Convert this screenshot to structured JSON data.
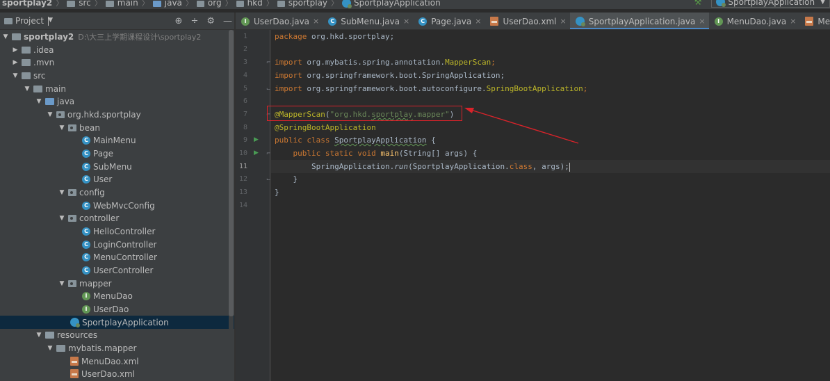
{
  "breadcrumb": {
    "items": [
      "sportplay2",
      "src",
      "main",
      "java",
      "org",
      "hkd",
      "sportplay",
      "SportplayApplication"
    ],
    "run_config": "SportplayApplication"
  },
  "project_panel": {
    "title": "Project",
    "tree": [
      {
        "label": "sportplay2",
        "path": "D:\\大三上学期课程设计\\sportplay2"
      },
      {
        "label": ".idea"
      },
      {
        "label": ".mvn"
      },
      {
        "label": "src"
      },
      {
        "label": "main"
      },
      {
        "label": "java"
      },
      {
        "label": "org.hkd.sportplay"
      },
      {
        "label": "bean"
      },
      {
        "label": "MainMenu"
      },
      {
        "label": "Page"
      },
      {
        "label": "SubMenu"
      },
      {
        "label": "User"
      },
      {
        "label": "config"
      },
      {
        "label": "WebMvcConfig"
      },
      {
        "label": "controller"
      },
      {
        "label": "HelloController"
      },
      {
        "label": "LoginController"
      },
      {
        "label": "MenuController"
      },
      {
        "label": "UserController"
      },
      {
        "label": "mapper"
      },
      {
        "label": "MenuDao"
      },
      {
        "label": "UserDao"
      },
      {
        "label": "SportplayApplication"
      },
      {
        "label": "resources"
      },
      {
        "label": "mybatis.mapper"
      },
      {
        "label": "MenuDao.xml"
      },
      {
        "label": "UserDao.xml"
      }
    ]
  },
  "tabs": [
    {
      "label": "UserDao.java"
    },
    {
      "label": "SubMenu.java"
    },
    {
      "label": "Page.java"
    },
    {
      "label": "UserDao.xml"
    },
    {
      "label": "SportplayApplication.java"
    },
    {
      "label": "MenuDao.java"
    },
    {
      "label": "MenuDao.xm"
    }
  ],
  "editor": {
    "line_numbers": [
      "1",
      "2",
      "3",
      "4",
      "5",
      "6",
      "7",
      "8",
      "9",
      "10",
      "11",
      "12",
      "13",
      "14"
    ],
    "current_line": "11",
    "code": {
      "l1_kw": "package",
      "l1_rest": " org.hkd.sportplay;",
      "l3_kw": "import",
      "l3_pkg": " org.mybatis.spring.annotation.",
      "l3_cls": "MapperScan",
      "l4_kw": "import",
      "l4_rest": " org.springframework.boot.SpringApplication;",
      "l5_kw": "import",
      "l5_pkg": " org.springframework.boot.autoconfigure.",
      "l5_cls": "SpringBootApplication",
      "l7_ann": "@MapperScan",
      "l7_open": "(",
      "l7_str1": "\"org.hkd.",
      "l7_str2": "sportplay",
      "l7_str3": ".mapper\"",
      "l7_close": ")",
      "l8_ann": "@SpringBootApplication",
      "l9_kw": "public class ",
      "l9_name": "SportplayApplication",
      "l9_rest": " {",
      "l10_kw": "    public static void ",
      "l10_fn": "main",
      "l10_rest": "(String[] args) {",
      "l11_a": "        SpringApplication.",
      "l11_run": "run",
      "l11_b": "(SportplayApplication.",
      "l11_kw": "class",
      "l11_c": ", args);",
      "l12": "    }",
      "l13": "}"
    }
  }
}
